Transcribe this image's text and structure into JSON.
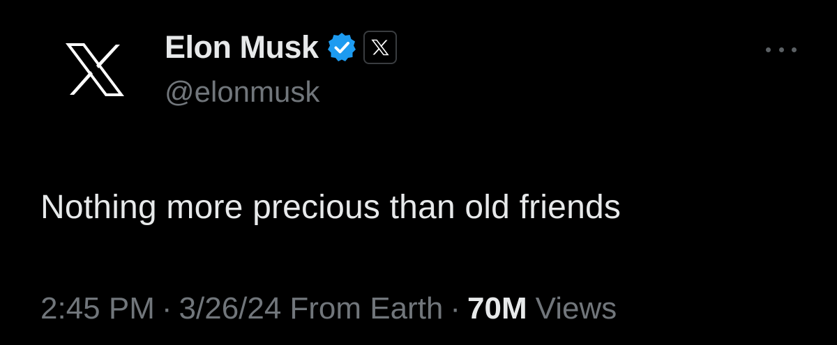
{
  "author": {
    "avatar_icon": "x-logo-icon",
    "display_name": "Elon Musk",
    "verified_icon": "verified-badge-icon",
    "verified_color": "#1d9bf0",
    "affiliate_icon": "x-logo-icon",
    "handle": "@elonmusk"
  },
  "menu": {
    "more_icon": "more-horizontal-icon"
  },
  "tweet": {
    "text": "Nothing more precious than old friends"
  },
  "meta": {
    "time": "2:45 PM",
    "date": "3/26/24",
    "source": "From Earth",
    "separator": "·",
    "views_count": "70M",
    "views_label": "Views"
  },
  "colors": {
    "background": "#000000",
    "primary_text": "#e7e9ea",
    "secondary_text": "#71767b"
  }
}
